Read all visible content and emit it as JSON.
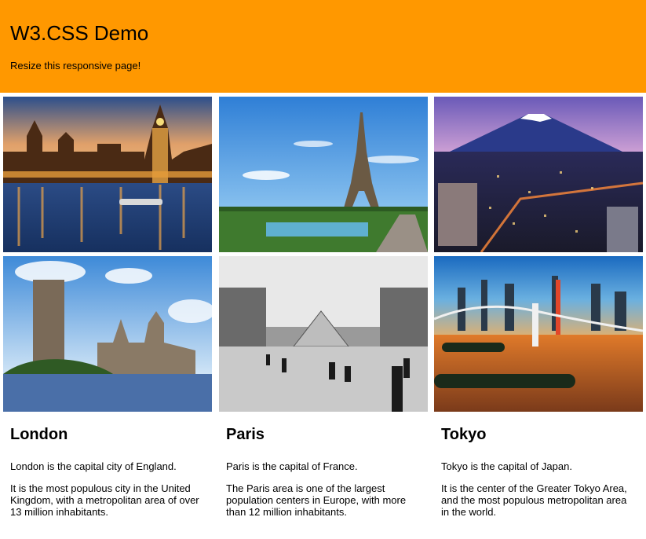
{
  "header": {
    "title": "W3.CSS Demo",
    "subtitle": "Resize this responsive page!",
    "color": "#ff9800"
  },
  "images": [
    {
      "name": "london-night-photo",
      "scene": "Houses of Parliament and Big Ben at night over the Thames"
    },
    {
      "name": "paris-eiffel-photo",
      "scene": "Eiffel Tower from the Trocadero gardens"
    },
    {
      "name": "tokyo-fuji-photo",
      "scene": "Tokyo cityscape at dusk with Mount Fuji"
    },
    {
      "name": "london-day-photo",
      "scene": "Palace of Westminster in daylight across the river"
    },
    {
      "name": "paris-louvre-photo",
      "scene": "Black and white Louvre pyramid courtyard"
    },
    {
      "name": "tokyo-bridge-photo",
      "scene": "Rainbow Bridge and Tokyo skyline at sunset"
    }
  ],
  "cities": [
    {
      "name": "London",
      "line1": "London is the capital city of England.",
      "line2": "It is the most populous city in the United Kingdom, with a metropolitan area of over 13 million inhabitants."
    },
    {
      "name": "Paris",
      "line1": "Paris is the capital of France.",
      "line2": "The Paris area is one of the largest population centers in Europe, with more than 12 million inhabitants."
    },
    {
      "name": "Tokyo",
      "line1": "Tokyo is the capital of Japan.",
      "line2": "It is the center of the Greater Tokyo Area, and the most populous metropolitan area in the world."
    }
  ]
}
